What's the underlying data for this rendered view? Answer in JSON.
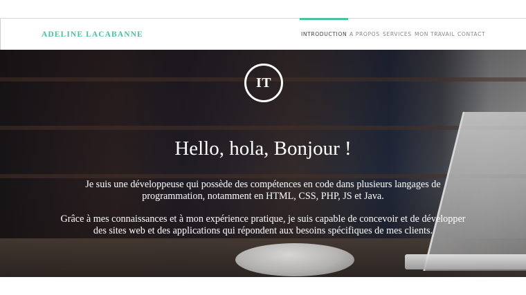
{
  "header": {
    "brand": "ADELINE LACABANNE",
    "nav": [
      {
        "label": "INTRODUCTION",
        "active": true
      },
      {
        "label": "A PROPOS",
        "active": false
      },
      {
        "label": "SERVICES",
        "active": false
      },
      {
        "label": "MON TRAVAIL",
        "active": false
      },
      {
        "label": "CONTACT",
        "active": false
      }
    ]
  },
  "hero": {
    "logo_text": "IT",
    "headline": "Hello, hola, Bonjour !",
    "paragraph1_line1": "Je suis une développeuse qui possède des compétences en code dans plusieurs langages de",
    "paragraph1_line2": "programmation, notamment en HTML, CSS, PHP, JS et Java.",
    "paragraph2_line1": "Grâce à mes connaissances et à mon expérience pratique, je suis capable de concevoir et de développer",
    "paragraph2_line2": "des sites web et des applications qui répondent aux besoins spécifiques de mes clients."
  },
  "colors": {
    "accent": "#4cbf9f",
    "nav_text": "#888888",
    "nav_active_text": "#444444",
    "hero_text": "#ffffff"
  }
}
